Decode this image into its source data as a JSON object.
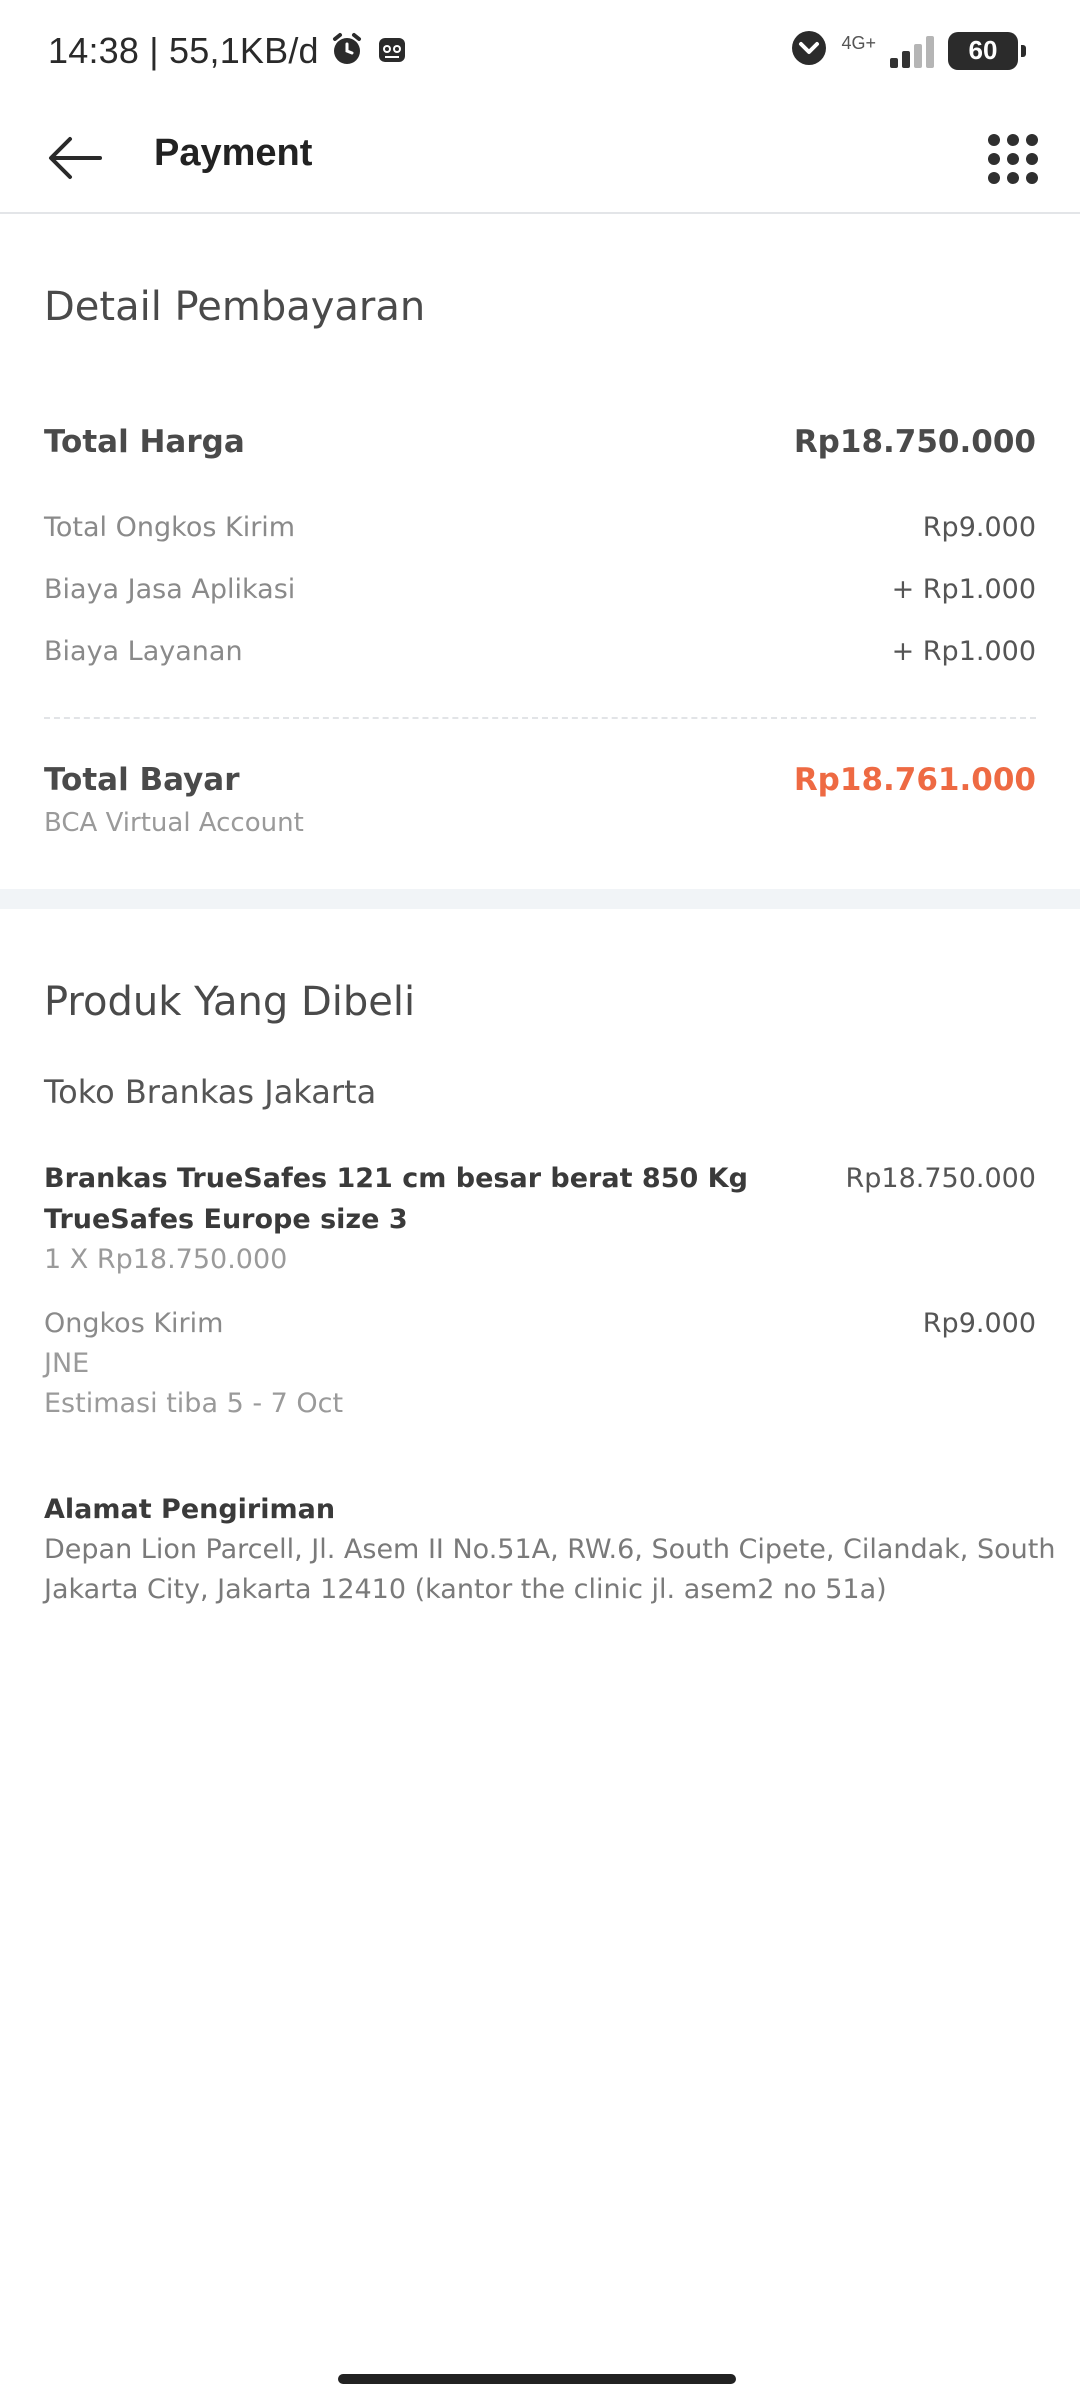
{
  "status_bar": {
    "time_and_speed": "14:38 | 55,1KB/d",
    "network": "4G+",
    "battery": "60"
  },
  "app_bar": {
    "title": "Payment"
  },
  "payment_detail": {
    "title": "Detail Pembayaran",
    "total_price_label": "Total Harga",
    "total_price_value": "Rp18.750.000",
    "shipping_label": "Total Ongkos Kirim",
    "shipping_value": "Rp9.000",
    "app_fee_label": "Biaya Jasa Aplikasi",
    "app_fee_value": "+ Rp1.000",
    "service_fee_label": "Biaya Layanan",
    "service_fee_value": "+ Rp1.000",
    "total_pay_label": "Total Bayar",
    "total_pay_value": "Rp18.761.000",
    "payment_method": "BCA Virtual Account",
    "accent_color": "#ee6a43"
  },
  "products": {
    "title": "Produk Yang Dibeli",
    "store_name": "Toko Brankas Jakarta",
    "item_name_line1": "Brankas TrueSafes 121 cm besar berat 850 Kg",
    "item_name_line2": "TrueSafes Europe size 3",
    "item_qty_price": "1 X Rp18.750.000",
    "item_total": "Rp18.750.000",
    "shipping_label": "Ongkos Kirim",
    "shipping_value": "Rp9.000",
    "courier": "JNE",
    "eta": "Estimasi tiba 5 - 7 Oct"
  },
  "address": {
    "label": "Alamat Pengiriman",
    "line1": "Depan Lion Parcell, Jl. Asem II No.51A, RW.6, South Cipete, Cilandak, South",
    "line2": "Jakarta City, Jakarta 12410 (kantor the clinic jl. asem2 no 51a)"
  },
  "icons": {
    "back": "arrow-left-icon",
    "menu": "grid-menu-icon",
    "alarm": "alarm-icon",
    "app_notif": "app-notification-icon",
    "data_saver": "chevron-down-circle-icon"
  }
}
